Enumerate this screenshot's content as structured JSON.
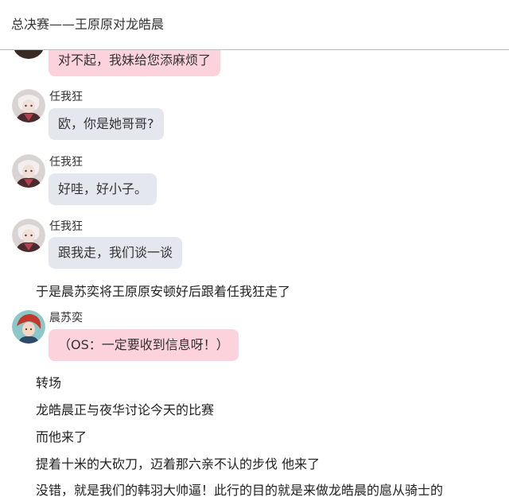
{
  "header": {
    "title": "总决赛——王原原对龙皓晨"
  },
  "messages": [
    {
      "sender": "",
      "avatar": "partial-avatar",
      "text": "对不起，我妹给您添麻烦了",
      "bubble_color": "#fcd3dc"
    },
    {
      "sender": "任我狂",
      "avatar": "renwokuang-avatar",
      "text": "欧，你是她哥哥?",
      "bubble_color": "#e4e7ee"
    },
    {
      "sender": "任我狂",
      "avatar": "renwokuang-avatar",
      "text": "好哇，好小子。",
      "bubble_color": "#e4e7ee"
    },
    {
      "sender": "任我狂",
      "avatar": "renwokuang-avatar",
      "text": "跟我走，我们谈一谈",
      "bubble_color": "#e4e7ee"
    },
    {
      "sender": "晨苏奕",
      "avatar": "chensuyi-avatar",
      "text": "（OS：一定要收到信息呀！）",
      "bubble_color": "#fcd3dc"
    }
  ],
  "narration": [
    "于是晨苏奕将王原原安顿好后跟着任我狂走了",
    "转场",
    "龙皓晨正与夜华讨论今天的比赛",
    "而他来了",
    "提着十米的大砍刀，迈着那六亲不认的步伐 他来了",
    "没错，就是我们的韩羽大帅逼！此行的目的就是来做龙皓晨的扈从骑士的"
  ]
}
